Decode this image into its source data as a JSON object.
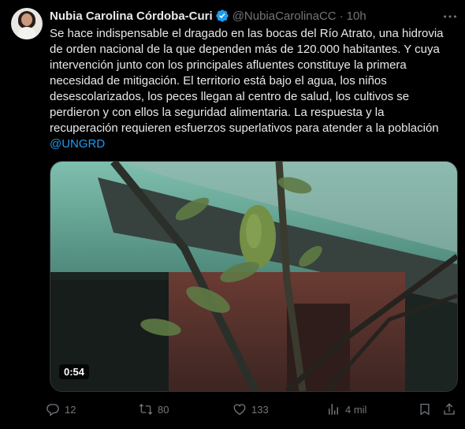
{
  "author": {
    "name": "Nubia Carolina Córdoba-Curi",
    "handle": "@NubiaCarolinaCC",
    "separator": "·",
    "time": "10h"
  },
  "tweet": {
    "text": "Se hace indispensable el dragado en las bocas del Río Atrato, una hidrovia de orden nacional de la que dependen más de 120.000 habitantes. Y cuya intervención junto con los principales afluentes constituye la primera necesidad de mitigación. El territorio está bajo el agua, los niños desescolarizados, los peces llegan al centro de salud, los cultivos se perdieron y con ellos la seguridad alimentaria. La respuesta y la recuperación requieren esfuerzos superlativos para atender a la población",
    "mention": "@UNGRD"
  },
  "media": {
    "duration": "0:54"
  },
  "actions": {
    "replies": "12",
    "reposts": "80",
    "likes": "133",
    "views": "4 mil"
  },
  "colors": {
    "background": "#000000",
    "text": "#e7e9ea",
    "secondary": "#71767b",
    "accent": "#1d9bf0"
  },
  "icons": [
    "verified-badge-icon",
    "more-icon",
    "reply-icon",
    "repost-icon",
    "like-icon",
    "views-icon",
    "bookmark-icon",
    "share-icon"
  ]
}
